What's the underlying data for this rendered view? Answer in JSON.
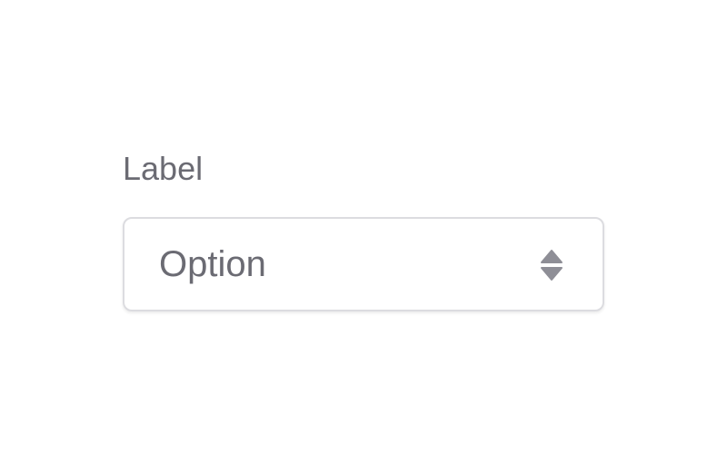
{
  "field": {
    "label": "Label",
    "selected_value": "Option",
    "icon": "chevron-up-down-icon",
    "colors": {
      "text": "#6b6b73",
      "border": "#dcdce0",
      "icon": "#8e8e96",
      "background": "#ffffff"
    }
  }
}
